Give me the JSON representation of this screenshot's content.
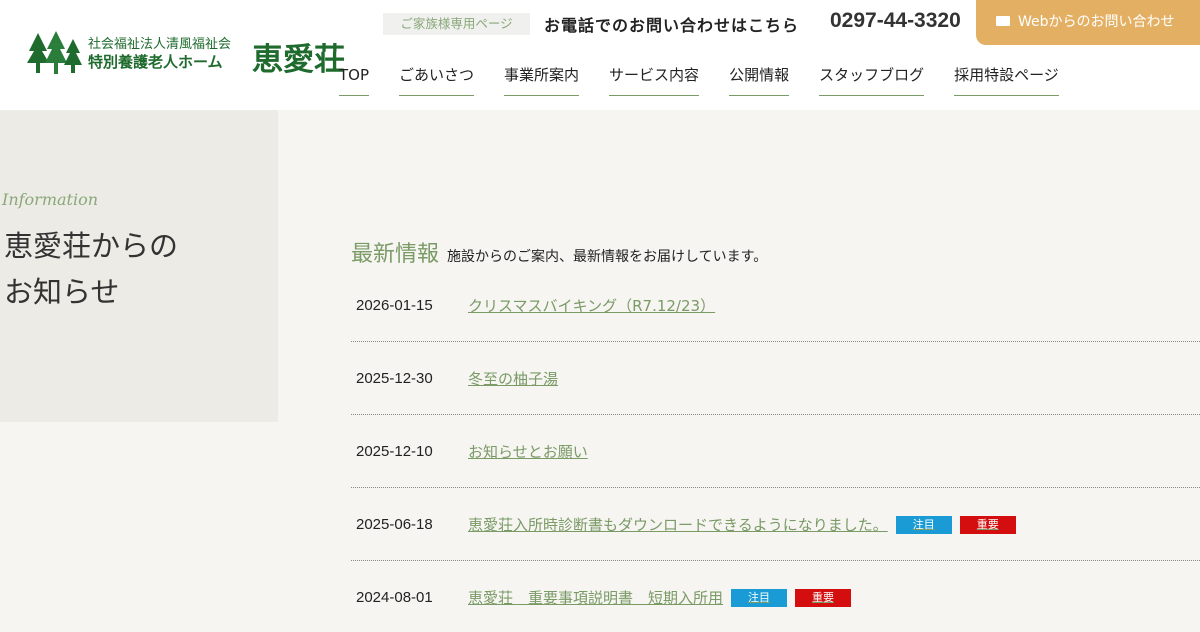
{
  "header": {
    "logo": {
      "line1": "社会福祉法人清風福祉会",
      "line2": "特別養護老人ホーム",
      "name": "恵愛荘"
    },
    "family_link": "ご家族様専用ページ",
    "contact_text": "お電話でのお問い合わせはこちら",
    "phone": "0297-44-3320",
    "web_contact": "Webからのお問い合わせ",
    "nav": [
      "TOP",
      "ごあいさつ",
      "事業所案内",
      "サービス内容",
      "公開情報",
      "スタッフブログ",
      "採用特設ページ"
    ]
  },
  "page_title": {
    "script_label": "Information",
    "line1": "恵愛荘からの",
    "line2": "お知らせ"
  },
  "news": {
    "title": "最新情報",
    "description": "施設からのご案内、最新情報をお届けしています。",
    "items": [
      {
        "date": "2026-01-15",
        "title": "クリスマスバイキング（R7.12/23）",
        "badges": []
      },
      {
        "date": "2025-12-30",
        "title": "冬至の柚子湯",
        "badges": []
      },
      {
        "date": "2025-12-10",
        "title": "お知らせとお願い",
        "badges": []
      },
      {
        "date": "2025-06-18",
        "title": "恵愛荘入所時診断書もダウンロードできるようになりました。",
        "badges": [
          "注目",
          "重要"
        ]
      },
      {
        "date": "2024-08-01",
        "title": "恵愛荘　重要事項説明書　短期入所用",
        "badges": [
          "注目",
          "重要"
        ]
      }
    ]
  },
  "colors": {
    "brand_green": "#1f6b2e",
    "accent_green": "#7a9a66",
    "web_button": "#e3b063",
    "badge_notice": "#1a9bd6",
    "badge_important": "#d40e0e"
  },
  "icons": {
    "logo": "pine-trees-icon",
    "web_contact": "mail-icon"
  }
}
